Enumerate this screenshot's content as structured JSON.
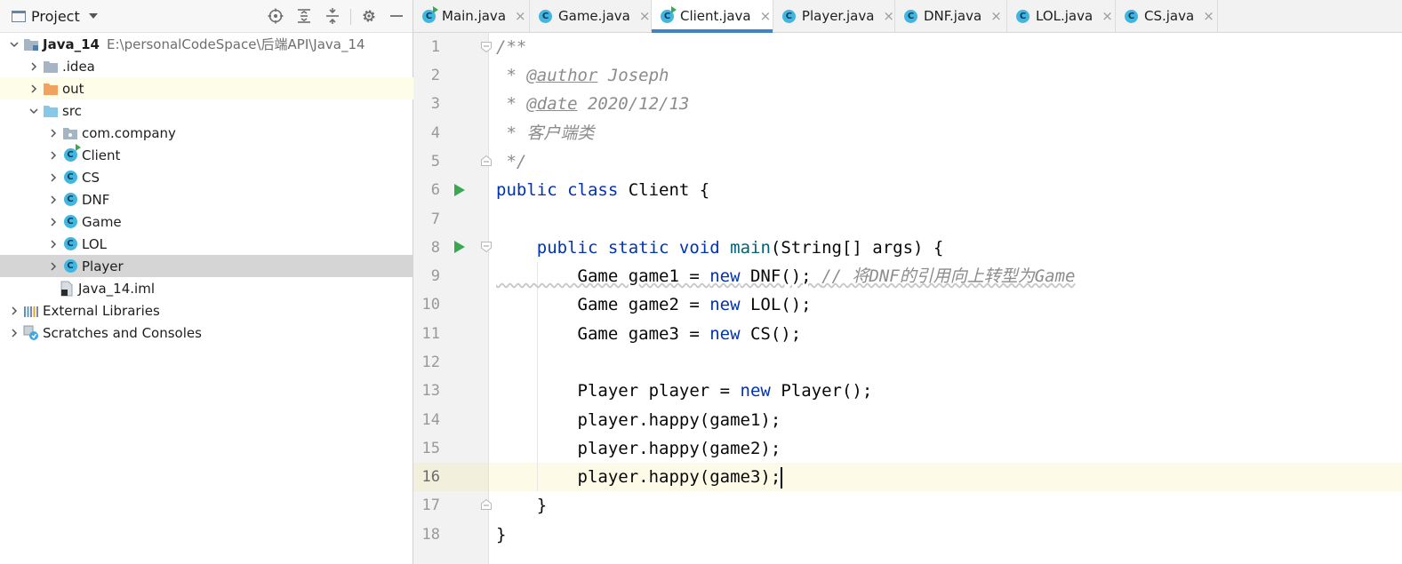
{
  "project_panel": {
    "title": "Project",
    "tree": [
      {
        "label": "Java_14",
        "hint": "E:\\personalCodeSpace\\后端API\\Java_14"
      },
      {
        "label": ".idea"
      },
      {
        "label": "out"
      },
      {
        "label": "src"
      },
      {
        "label": "com.company"
      },
      {
        "label": "Client"
      },
      {
        "label": "CS"
      },
      {
        "label": "DNF"
      },
      {
        "label": "Game"
      },
      {
        "label": "LOL"
      },
      {
        "label": "Player"
      },
      {
        "label": "Java_14.iml"
      },
      {
        "label": "External Libraries"
      },
      {
        "label": "Scratches and Consoles"
      }
    ],
    "class_icon_letter": "C"
  },
  "tabs": [
    {
      "label": "Main.java",
      "close": "×"
    },
    {
      "label": "Game.java",
      "close": "×"
    },
    {
      "label": "Client.java",
      "close": "×"
    },
    {
      "label": "Player.java",
      "close": "×"
    },
    {
      "label": "DNF.java",
      "close": "×"
    },
    {
      "label": "LOL.java",
      "close": "×"
    },
    {
      "label": "CS.java",
      "close": "×"
    }
  ],
  "editor": {
    "line_numbers": [
      "1",
      "2",
      "3",
      "4",
      "5",
      "6",
      "7",
      "8",
      "9",
      "10",
      "11",
      "12",
      "13",
      "14",
      "15",
      "16",
      "17",
      "18"
    ],
    "code": {
      "l1": "/**",
      "l2a": " * ",
      "l2tag": "@author",
      "l2b": " Joseph",
      "l3a": " * ",
      "l3tag": "@date",
      "l3b": " 2020/12/13",
      "l4": " * 客户端类",
      "l5": " */",
      "l6kw": "public class",
      "l6b": " Client {",
      "l8indent": "    ",
      "l8kw": "public static void",
      "l8fn": "main",
      "l8b": "(String[] args) {",
      "l9a": "        Game game1 = ",
      "l9kw": "new",
      "l9b": " DNF(); ",
      "l9cm": "// 将DNF的引用向上转型为Game",
      "l10a": "        Game game2 = ",
      "l10kw": "new",
      "l10b": " LOL();",
      "l11a": "        Game game3 = ",
      "l11kw": "new",
      "l11b": " CS();",
      "l13a": "        Player player = ",
      "l13kw": "new",
      "l13b": " Player();",
      "l14": "        player.happy(game1);",
      "l15": "        player.happy(game2);",
      "l16": "        player.happy(game3);",
      "l17": "    }",
      "l18": "}"
    }
  },
  "colors": {
    "keyword": "#0033b3",
    "function": "#00627a",
    "comment": "#8c8c8c",
    "class_icon": "#40b6e0",
    "run_icon": "#3aa853",
    "active_tab_underline": "#4083c9",
    "folder_orange": "#f0a35f",
    "folder_blue": "#86c8e8"
  }
}
